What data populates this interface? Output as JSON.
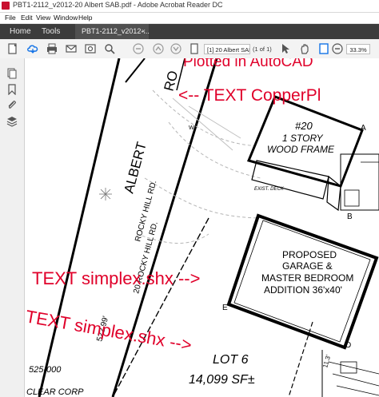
{
  "window": {
    "title": "PBT1-2112_v2012-20 Albert SAB.pdf - Adobe Acrobat Reader DC"
  },
  "menu": [
    "File",
    "Edit",
    "View",
    "Window",
    "Help"
  ],
  "tabs": {
    "home": "Home",
    "tools": "Tools",
    "document": "PBT1-2112_v2012-...",
    "close": "×"
  },
  "toolbar": {
    "page_field": "[1] 20 Albert SAB",
    "page_count": "(1 of 1)",
    "zoom": "33.3%"
  },
  "document": {
    "annotations": {
      "plotted": "Plotted in AutoCAD",
      "text_copper": "<-- TEXT CopperPl",
      "text_simplex_1": "TEXT simplex.shx -->",
      "text_simplex_2": "TEXT simplex.shx -->"
    },
    "drawing": {
      "road_name": "ALBERT",
      "road_name_2": "RO",
      "rocky_hill": "ROCKY HILL RD.",
      "rocky_hill_2": "20 ROCKY HILL RD.",
      "distance": "522.99'",
      "house_num": "#20",
      "house_story": "1 STORY",
      "house_frame": "WOOD FRAME",
      "deck": "EXIST. DECK",
      "proposed_1": "PROPOSED",
      "proposed_2": "GARAGE &",
      "proposed_3": "MASTER BEDROOM",
      "proposed_4": "ADDITION 36'x40'",
      "lot": "LOT 6",
      "lot_area": "14,099 SF±",
      "parcel": "525-000",
      "owner": "CLEAR CORP",
      "dim_side": "11.3'",
      "point_a": "A",
      "point_b": "B",
      "point_d": "D",
      "point_e": "E",
      "point_w": "W"
    }
  }
}
